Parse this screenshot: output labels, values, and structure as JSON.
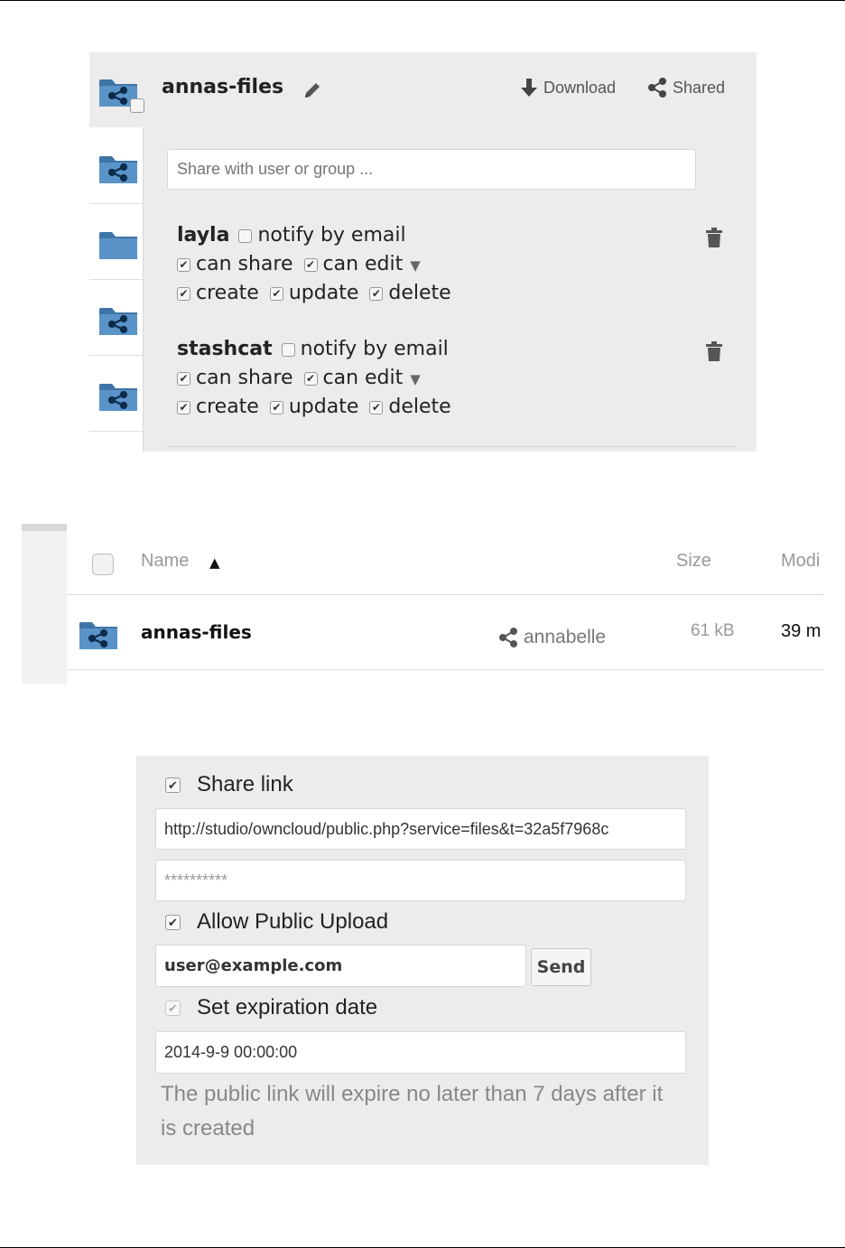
{
  "share_panel": {
    "folder_name": "annas-files",
    "download_label": "Download",
    "shared_label": "Shared",
    "share_input_placeholder": "Share with user or group ...",
    "recipients": [
      {
        "name": "layla",
        "notify_label": "notify by email",
        "notify_checked": false,
        "can_share_label": "can share",
        "can_share_checked": true,
        "can_edit_label": "can edit",
        "can_edit_checked": true,
        "create_label": "create",
        "update_label": "update",
        "delete_label": "delete"
      },
      {
        "name": "stashcat",
        "notify_label": "notify by email",
        "notify_checked": false,
        "can_share_label": "can share",
        "can_share_checked": true,
        "can_edit_label": "can edit",
        "can_edit_checked": true,
        "create_label": "create",
        "update_label": "update",
        "delete_label": "delete"
      }
    ]
  },
  "file_list": {
    "columns": {
      "name": "Name",
      "size": "Size",
      "modified": "Modi"
    },
    "sort_indicator": "▲",
    "rows": [
      {
        "name": "annas-files",
        "owner": "annabelle",
        "size": "61 kB",
        "modified": "39 m"
      }
    ]
  },
  "link_panel": {
    "share_link_label": "Share link",
    "share_link_checked": true,
    "link_url": "http://studio/owncloud/public.php?service=files&t=32a5f7968c",
    "password_value": "**********",
    "allow_upload_label": "Allow Public Upload",
    "allow_upload_checked": true,
    "email_value": "user@example.com",
    "send_label": "Send",
    "expiration_label": "Set expiration date",
    "expiration_checked": true,
    "expiration_value": "2014-9-9 00:00:00",
    "expiry_note": "The public link will expire no later than 7 days after it is created"
  },
  "colors": {
    "folder_blue": "#4f86b8",
    "panel_bg": "#ececec",
    "muted_text": "#888888"
  },
  "icons": [
    "shared-folder-icon",
    "folder-icon",
    "pencil-icon",
    "download-icon",
    "share-icon",
    "trash-icon",
    "sort-ascending-icon"
  ]
}
